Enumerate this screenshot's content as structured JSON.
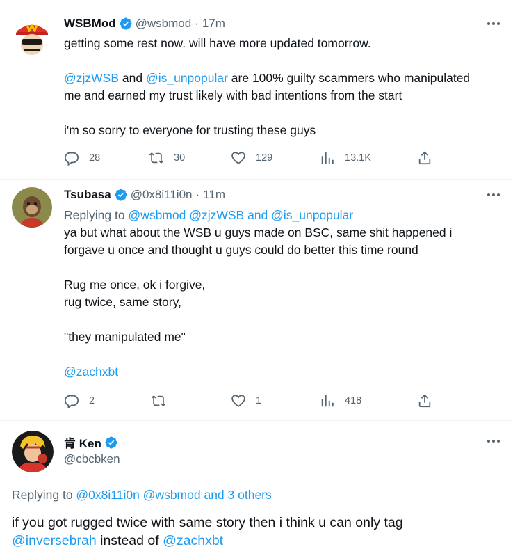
{
  "tweets": [
    {
      "name": "WSBMod",
      "handle": "@wsbmod",
      "time": "17m",
      "line1": "getting some rest now. will have more updated tomorrow.",
      "mention1": "@zjzWSB",
      "and": " and ",
      "mention2": "@is_unpopular",
      "line2a": " are 100% guilty scammers who manipulated",
      "line2b": "me and earned my trust likely with bad intentions from the start",
      "line3": "i'm so sorry to everyone for trusting these guys",
      "stats": {
        "replies": "28",
        "retweets": "30",
        "likes": "129",
        "views": "13.1K"
      }
    },
    {
      "name": "Tsubasa",
      "handle": "@0x8i11i0n",
      "time": "11m",
      "replying_prefix": "Replying to ",
      "replying_targets": "@wsbmod @zjzWSB and @is_unpopular",
      "line1": "ya but what about the WSB u guys made on BSC, same shit happened i",
      "line2": "forgave u once and thought u guys could do better this time round",
      "line3": "Rug me once, ok i forgive,",
      "line4": "rug twice, same story,",
      "line5": "\"they manipulated me\"",
      "mention": "@zachxbt",
      "stats": {
        "replies": "2",
        "retweets": "",
        "likes": "1",
        "views": "418"
      }
    },
    {
      "name": "肯 Ken",
      "handle": "@cbcbken",
      "replying_prefix": "Replying to ",
      "replying_targets": "@0x8i11i0n @wsbmod and 3 others",
      "line1": "if you got rugged twice with same story then i think u can only tag",
      "mention1": "@inversebrah",
      "mid": " instead of ",
      "mention2": "@zachxbt"
    }
  ],
  "icons": {
    "reply": "reply-icon",
    "retweet": "retweet-icon",
    "like": "heart-icon",
    "views": "views-icon",
    "share": "share-icon",
    "verified": "verified-badge-icon",
    "more": "more-options-icon"
  },
  "colors": {
    "link": "#1d9bf0",
    "secondary": "#536471",
    "verified": "#1d9bf0",
    "text": "#0f1419"
  }
}
